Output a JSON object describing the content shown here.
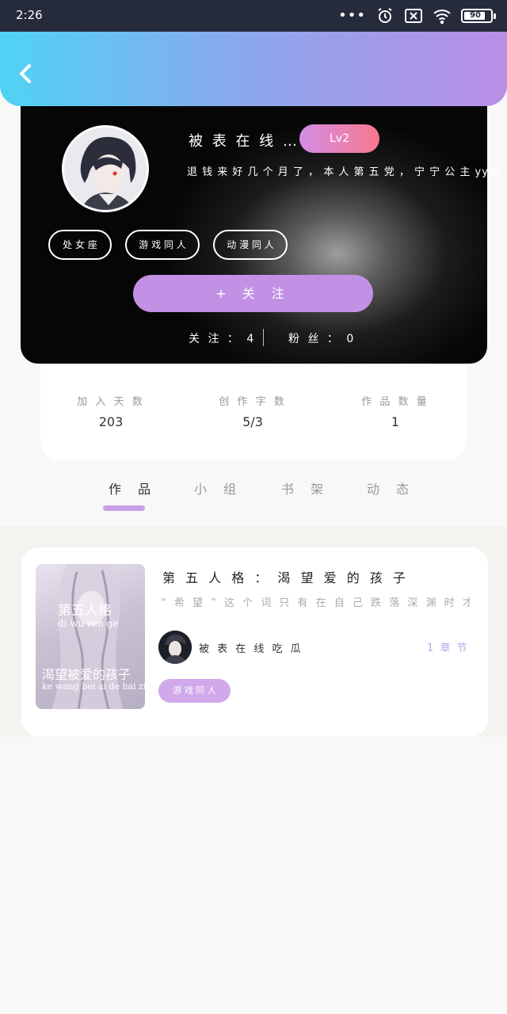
{
  "status_bar": {
    "time": "2:26",
    "dots": "•••",
    "battery": "90"
  },
  "header": {
    "back_icon": "chevron-left-icon"
  },
  "profile": {
    "username": "被 表 在 线 …",
    "level": "Lv2",
    "bio": "退 钱 来 好 几 个 月 了 ， 本 人 第 五 党 ， 宁 宁 公 主 yyds",
    "tags": [
      "处 女 座",
      "游 戏 同 人",
      "动 漫 同 人"
    ],
    "follow_label": "关 注",
    "follow_icon": "+",
    "following_label": "关 注 ： 4",
    "fans_label": "粉 丝 ： 0"
  },
  "stats": [
    {
      "label": "加 入 天 数",
      "value": "203"
    },
    {
      "label": "创 作 字 数",
      "value": "5/3"
    },
    {
      "label": "作 品 数 量",
      "value": "1"
    }
  ],
  "tabs": [
    {
      "label": "作 品",
      "active": true
    },
    {
      "label": "小 组",
      "active": false
    },
    {
      "label": "书 架",
      "active": false
    },
    {
      "label": "动 态",
      "active": false
    }
  ],
  "work": {
    "cover_title": "第五人格",
    "cover_pinyin": "di wu ren ge",
    "cover_subtitle": "渴望被爱的孩子",
    "cover_subtitle_pinyin": "ke wang bei ai de hai zi",
    "title": "第 五 人 格 ： 渴 望 爱 的 孩 子",
    "description": "“ 希 望 ” 这 个 词 只 有 在 自 己 跌 落 深 渊 时 才 会 想 …",
    "author": "被 表 在 线 吃 瓜",
    "chapters": "1 章 节",
    "tag": "游 戏 同 人"
  }
}
